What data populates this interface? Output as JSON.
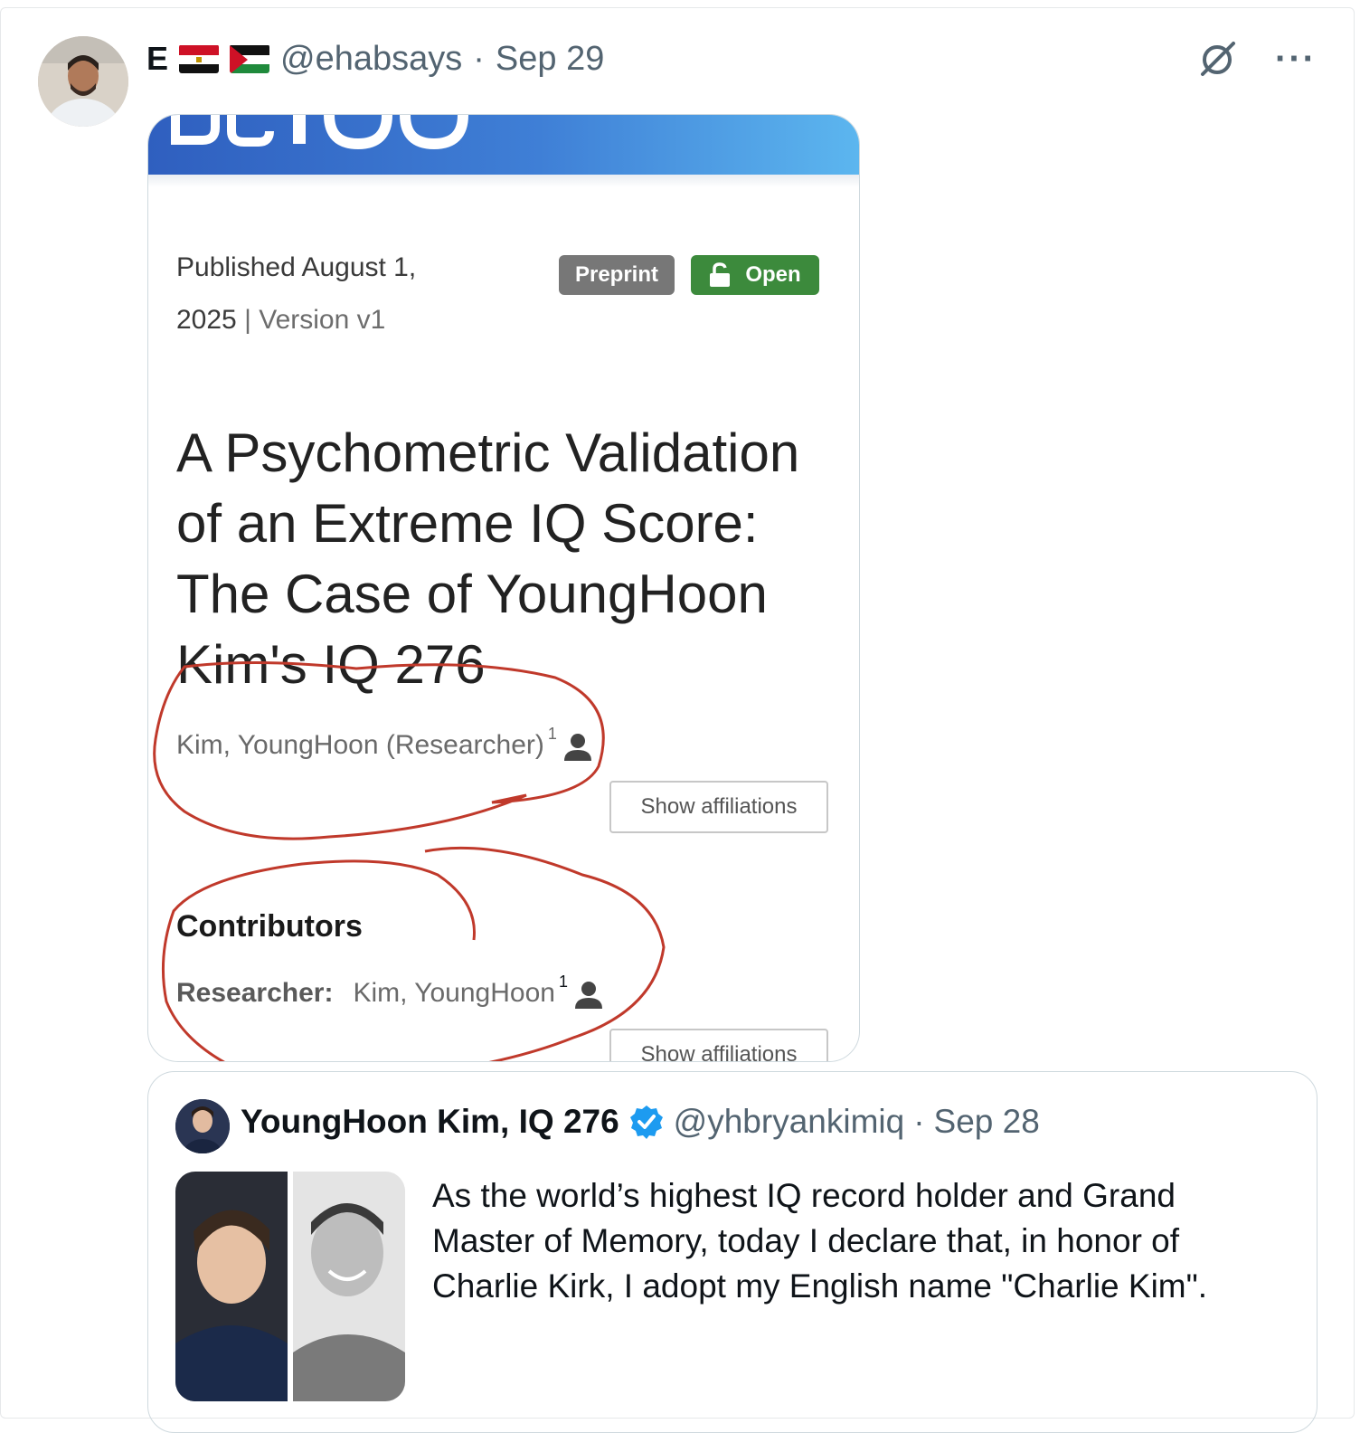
{
  "tweet": {
    "display_name": "E",
    "flags": [
      "egypt-flag",
      "palestine-flag"
    ],
    "handle": "@ehabsays",
    "separator": "·",
    "date": "Sep 29",
    "more_label": "···"
  },
  "screenshot": {
    "banner_text": "ZENODO",
    "published_line1": "Published August 1,",
    "published_year": "2025",
    "version": "| Version v1",
    "badge_preprint": "Preprint",
    "badge_open": "Open",
    "title": "A Psychometric Validation of an Extreme IQ Score: The Case of YoungHoon Kim's IQ 276",
    "author": "Kim, YoungHoon (Researcher)",
    "author_sup": "1",
    "show_affiliations": "Show affiliations",
    "contributors_heading": "Contributors",
    "researcher_label": "Researcher:",
    "researcher_name": "Kim, YoungHoon",
    "researcher_sup": "1",
    "show_affiliations_2": "Show affiliations"
  },
  "quote": {
    "name": "YoungHoon Kim, IQ 276",
    "handle": "@yhbryankimiq",
    "separator": "·",
    "date": "Sep 28",
    "text": "As the world’s highest IQ record holder and Grand Master of Memory, today I declare that, in honor of Charlie Kirk, I adopt my English name \"Charlie Kim\"."
  },
  "colors": {
    "open_badge": "#3c8a3c",
    "preprint_badge": "#777777",
    "verified": "#1d9bf0",
    "annotation_ink": "#c0392b"
  }
}
